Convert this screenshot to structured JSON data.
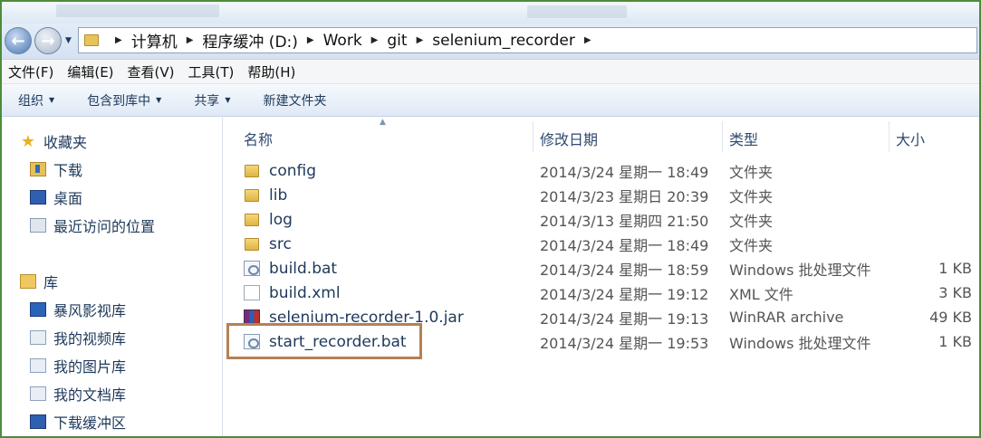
{
  "address": {
    "crumbs": [
      "计算机",
      "程序缓冲 (D:)",
      "Work",
      "git",
      "selenium_recorder"
    ]
  },
  "menu": [
    "文件(F)",
    "编辑(E)",
    "查看(V)",
    "工具(T)",
    "帮助(H)"
  ],
  "commands": [
    {
      "label": "组织",
      "dropdown": true
    },
    {
      "label": "包含到库中",
      "dropdown": true
    },
    {
      "label": "共享",
      "dropdown": true
    },
    {
      "label": "新建文件夹",
      "dropdown": false
    }
  ],
  "sidebar": {
    "favorites": {
      "title": "收藏夹",
      "items": [
        {
          "label": "下载",
          "icon": "download-folder-icon"
        },
        {
          "label": "桌面",
          "icon": "desktop-icon"
        },
        {
          "label": "最近访问的位置",
          "icon": "recent-places-icon"
        }
      ]
    },
    "libraries": {
      "title": "库",
      "items": [
        {
          "label": "暴风影视库",
          "icon": "film-library-icon"
        },
        {
          "label": "我的视频库",
          "icon": "video-library-icon"
        },
        {
          "label": "我的图片库",
          "icon": "picture-library-icon"
        },
        {
          "label": "我的文档库",
          "icon": "document-library-icon"
        },
        {
          "label": "下载缓冲区",
          "icon": "download-buffer-icon"
        }
      ]
    }
  },
  "columns": {
    "name": "名称",
    "date": "修改日期",
    "type": "类型",
    "size": "大小"
  },
  "files": [
    {
      "name": "config",
      "date": "2014/3/24 星期一 18:49",
      "type": "文件夹",
      "size": "",
      "icon": "folder-icon"
    },
    {
      "name": "lib",
      "date": "2014/3/23 星期日 20:39",
      "type": "文件夹",
      "size": "",
      "icon": "folder-icon"
    },
    {
      "name": "log",
      "date": "2014/3/13 星期四 21:50",
      "type": "文件夹",
      "size": "",
      "icon": "folder-icon"
    },
    {
      "name": "src",
      "date": "2014/3/24 星期一 18:49",
      "type": "文件夹",
      "size": "",
      "icon": "folder-icon"
    },
    {
      "name": "build.bat",
      "date": "2014/3/24 星期一 18:59",
      "type": "Windows 批处理文件",
      "size": "1 KB",
      "icon": "batch-file-icon"
    },
    {
      "name": "build.xml",
      "date": "2014/3/24 星期一 19:12",
      "type": "XML 文件",
      "size": "3 KB",
      "icon": "xml-file-icon"
    },
    {
      "name": "selenium-recorder-1.0.jar",
      "date": "2014/3/24 星期一 19:13",
      "type": "WinRAR archive",
      "size": "49 KB",
      "icon": "winrar-archive-icon"
    },
    {
      "name": "start_recorder.bat",
      "date": "2014/3/24 星期一 19:53",
      "type": "Windows 批处理文件",
      "size": "1 KB",
      "icon": "batch-file-icon"
    }
  ],
  "colors": {
    "highlight_border": "#b38156",
    "frame_border": "#4c8c3c"
  }
}
